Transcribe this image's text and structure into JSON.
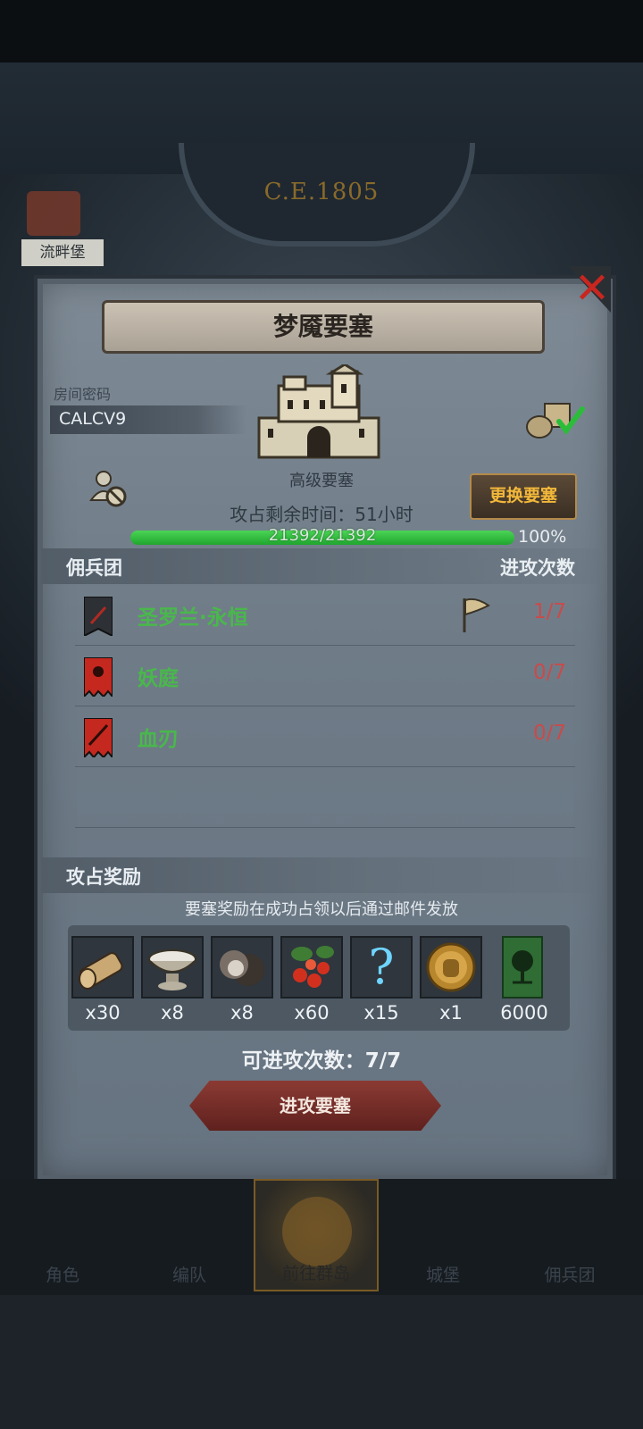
{
  "background": {
    "era": "C.E.1805",
    "left_label": "流畔堡"
  },
  "dialog": {
    "title": "梦魇要塞",
    "room_code_label": "房间密码",
    "room_code": "CALCV9",
    "fortress_type": "高级要塞",
    "change_button": "更换要塞",
    "remaining_time_label": "攻占剩余时间：",
    "remaining_time_value": "51小时",
    "hp_text": "21392/21392",
    "hp_percent_label": "100%",
    "hp_fraction": 1.0,
    "mercenaries_header": "佣兵团",
    "attacks_header": "进攻次数",
    "mercenaries": [
      {
        "name": "圣罗兰·永恒",
        "count": "1/7",
        "banner": "dark-banner-icon",
        "flag": true
      },
      {
        "name": "妖庭",
        "count": "0/7",
        "banner": "red-sun-banner-icon",
        "flag": false
      },
      {
        "name": "血刃",
        "count": "0/7",
        "banner": "red-blade-banner-icon",
        "flag": false
      }
    ],
    "rewards_header": "攻占奖励",
    "rewards_note": "要塞奖励在成功占领以后通过邮件发放",
    "rewards": [
      {
        "icon": "wood-log-icon",
        "qty": "x30"
      },
      {
        "icon": "stone-bowl-icon",
        "qty": "x8"
      },
      {
        "icon": "truffle-icon",
        "qty": "x8"
      },
      {
        "icon": "berries-icon",
        "qty": "x60"
      },
      {
        "icon": "mystery-question-icon",
        "qty": "x15"
      },
      {
        "icon": "knight-medal-icon",
        "qty": "x1"
      },
      {
        "icon": "tree-banner-icon",
        "qty": "6000"
      }
    ],
    "available_attacks": "可进攻次数：7/7",
    "attack_button": "进攻要塞"
  },
  "nav": [
    {
      "label": "角色",
      "active": false
    },
    {
      "label": "编队",
      "active": false
    },
    {
      "label": "前往群岛",
      "active": true
    },
    {
      "label": "城堡",
      "active": false
    },
    {
      "label": "佣兵团",
      "active": false
    }
  ],
  "colors": {
    "accent_green": "#49b84b",
    "count_red": "#c84b4b",
    "button_gold": "#f2b83a",
    "close_red": "#c8261f"
  }
}
